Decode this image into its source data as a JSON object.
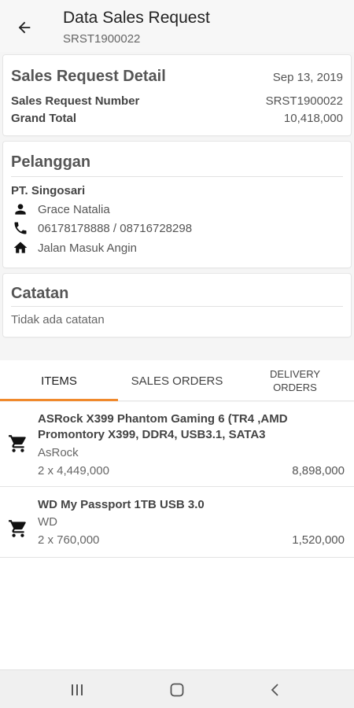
{
  "header": {
    "title": "Data Sales Request",
    "subtitle": "SRST1900022",
    "back_icon": "arrow-left-icon"
  },
  "detail": {
    "title": "Sales Request Detail",
    "date": "Sep 13, 2019",
    "rows": [
      {
        "label": "Sales Request Number",
        "value": "SRST1900022"
      },
      {
        "label": "Grand Total",
        "value": "10,418,000"
      }
    ]
  },
  "customer": {
    "title": "Pelanggan",
    "company": "PT. Singosari",
    "contact": "Grace Natalia",
    "phone": "06178178888 / 08716728298",
    "address": "Jalan Masuk Angin",
    "icons": {
      "contact": "person-icon",
      "phone": "phone-icon",
      "address": "home-icon"
    }
  },
  "notes": {
    "title": "Catatan",
    "text": "Tidak ada catatan"
  },
  "tabs": [
    {
      "label": "ITEMS",
      "active": true
    },
    {
      "label": "SALES ORDERS",
      "active": false
    },
    {
      "label": "DELIVERY\nORDERS",
      "active": false
    }
  ],
  "items": [
    {
      "name": "ASRock X399 Phantom Gaming 6 (TR4 ,AMD Promontory X399, DDR4, USB3.1, SATA3",
      "brand": "AsRock",
      "qty_price": "2 x 4,449,000",
      "total": "8,898,000",
      "icon": "cart-icon"
    },
    {
      "name": "WD My Passport 1TB USB 3.0",
      "brand": "WD",
      "qty_price": "2 x 760,000",
      "total": "1,520,000",
      "icon": "cart-icon"
    }
  ],
  "colors": {
    "accent": "#f0892c",
    "background": "#f5f5f5",
    "card": "#ffffff"
  },
  "navbar": {
    "icons": [
      "recents-icon",
      "home-circle-icon",
      "back-chevron-icon"
    ]
  }
}
